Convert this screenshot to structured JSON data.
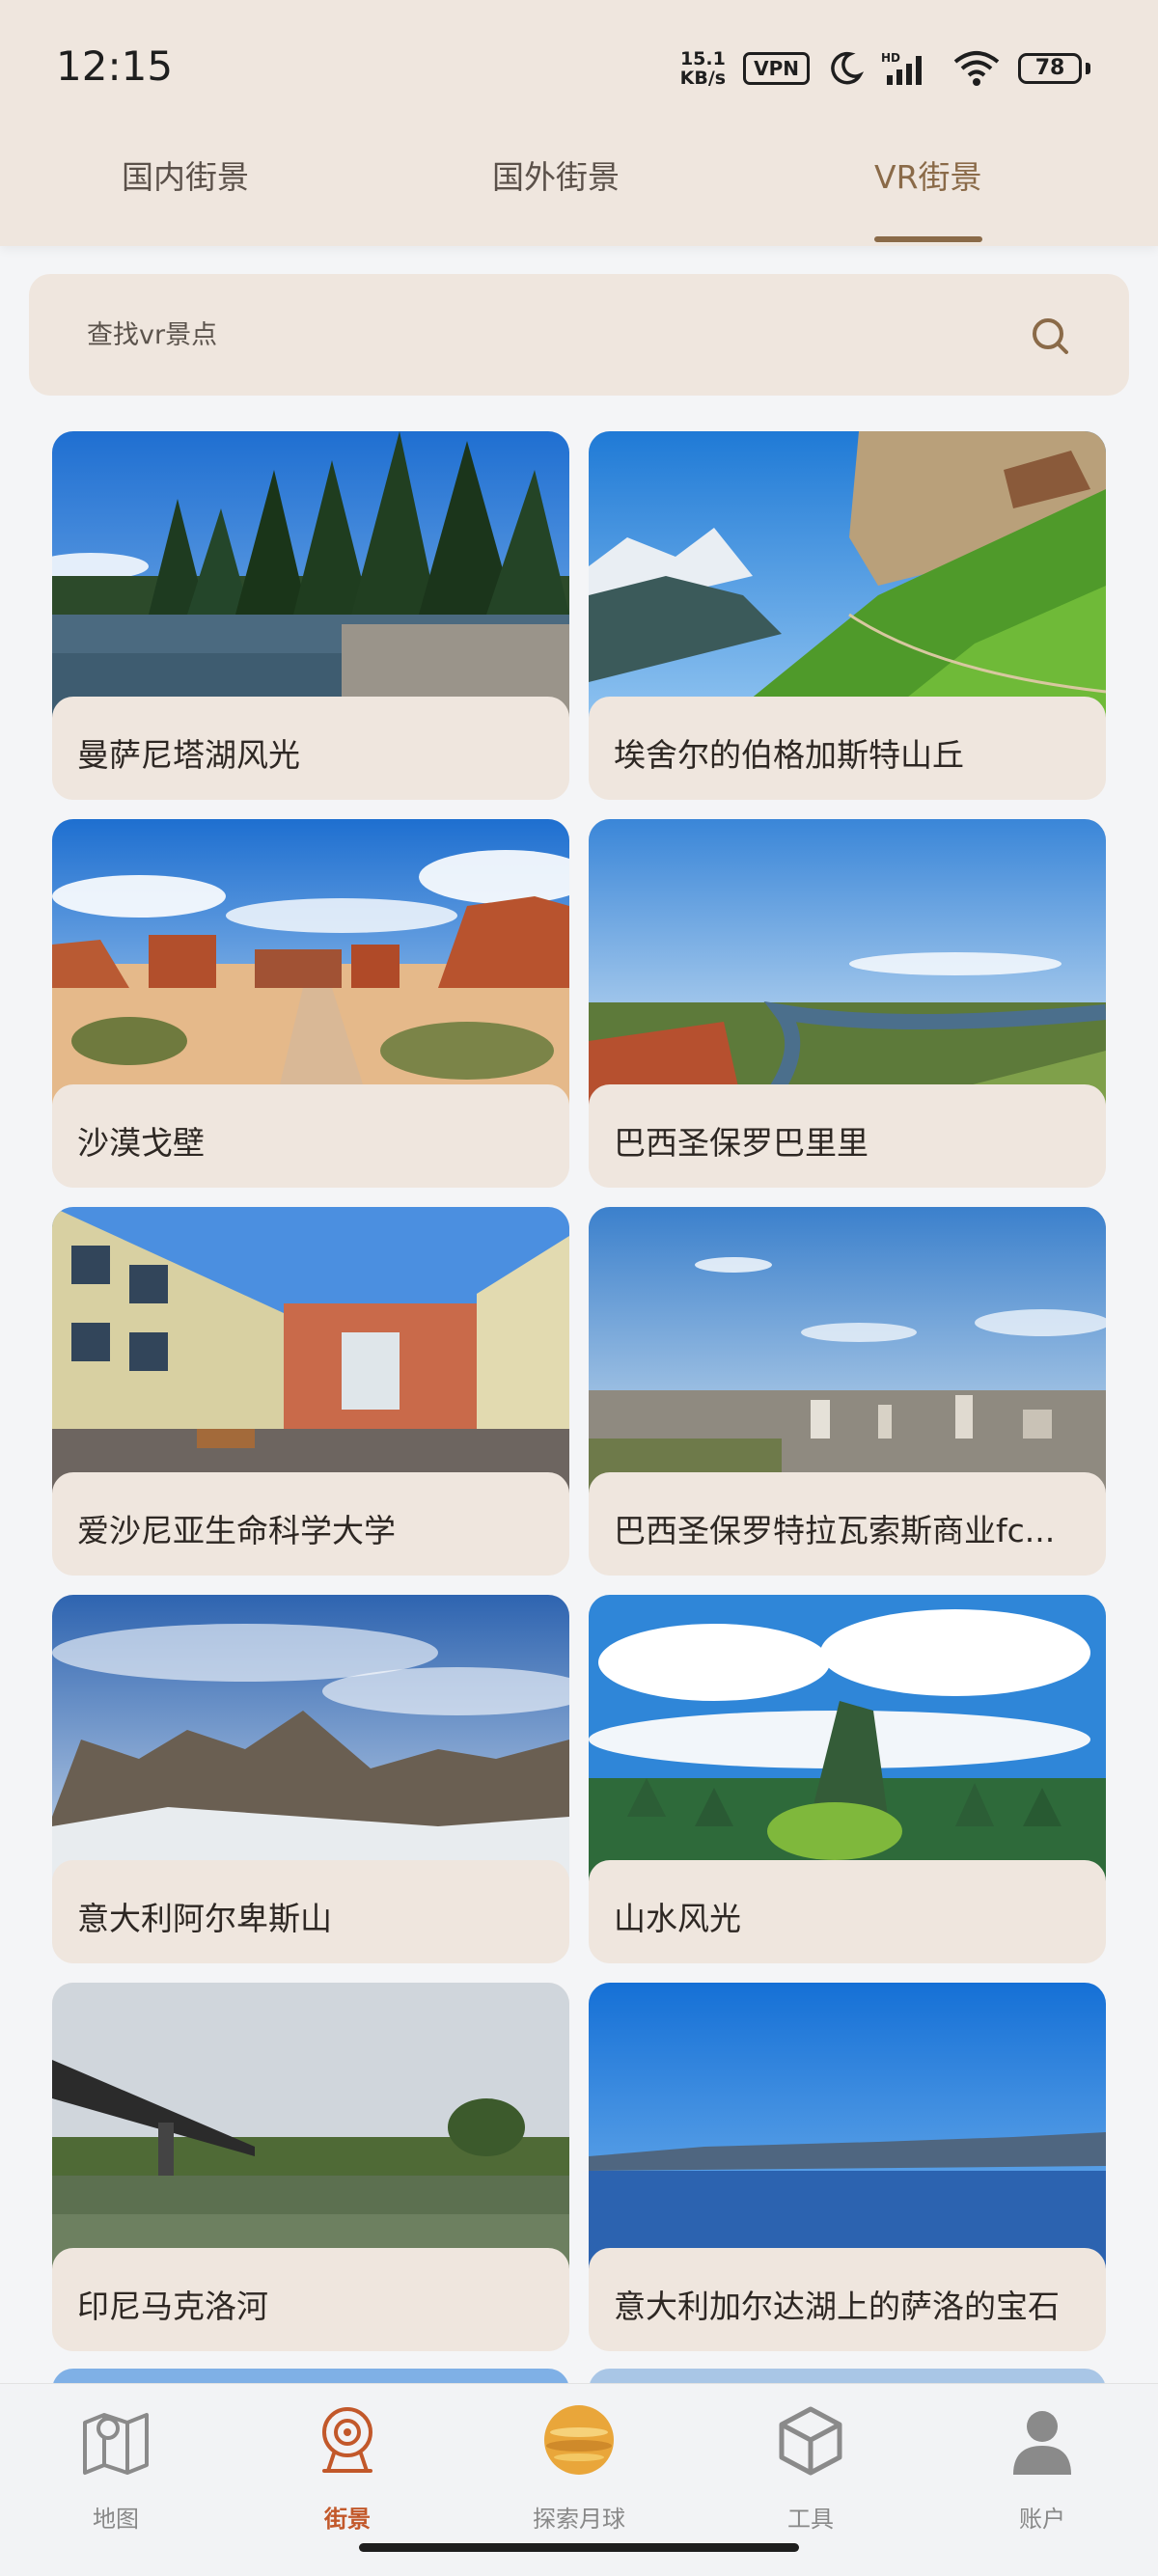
{
  "status_bar": {
    "time": "12:15",
    "speed_value": "15.1",
    "speed_unit": "KB/s",
    "vpn": "VPN",
    "battery": "78"
  },
  "tabs": [
    {
      "label": "国内街景"
    },
    {
      "label": "国外街景"
    },
    {
      "label": "VR街景"
    }
  ],
  "active_tab": "VR街景",
  "search": {
    "placeholder": "查找vr景点"
  },
  "cards": [
    {
      "title": "曼萨尼塔湖风光"
    },
    {
      "title": "埃舍尔的伯格加斯特山丘"
    },
    {
      "title": "沙漠戈壁"
    },
    {
      "title": "巴西圣保罗巴里里"
    },
    {
      "title": "爱沙尼亚生命科学大学"
    },
    {
      "title": "巴西圣保罗特拉瓦索斯商业fc..."
    },
    {
      "title": "意大利阿尔卑斯山"
    },
    {
      "title": "山水风光"
    },
    {
      "title": "印尼马克洛河"
    },
    {
      "title": "意大利加尔达湖上的萨洛的宝石"
    }
  ],
  "bottom_nav": [
    {
      "label": "地图",
      "icon": "map-icon"
    },
    {
      "label": "街景",
      "icon": "streetview-icon"
    },
    {
      "label": "探索月球",
      "icon": "moon-icon"
    },
    {
      "label": "工具",
      "icon": "cube-icon"
    },
    {
      "label": "账户",
      "icon": "account-icon"
    }
  ],
  "colors": {
    "accent": "#8a6a48",
    "nav_active": "#c2582a",
    "surface": "#efe6de"
  }
}
